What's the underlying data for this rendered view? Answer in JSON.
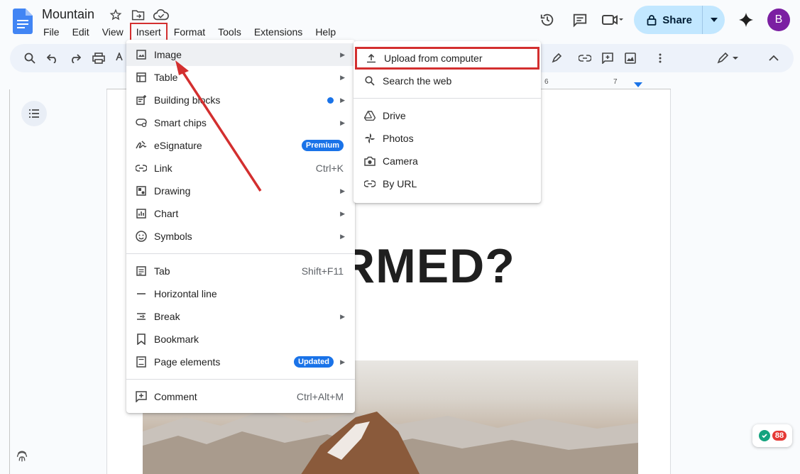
{
  "doc": {
    "title": "Mountain"
  },
  "menubar": [
    "File",
    "Edit",
    "View",
    "Insert",
    "Format",
    "Tools",
    "Extensions",
    "Help"
  ],
  "share": {
    "label": "Share"
  },
  "avatar": {
    "initial": "B",
    "color": "#7b1fa2"
  },
  "ruler": {
    "labels": [
      "6",
      "7"
    ]
  },
  "page": {
    "heading_fragment": "RMED?"
  },
  "insert_menu": {
    "items": [
      {
        "label": "Image",
        "icon": "image-icon",
        "submenu": true
      },
      {
        "label": "Table",
        "icon": "table-icon",
        "submenu": true
      },
      {
        "label": "Building blocks",
        "icon": "building-blocks-icon",
        "submenu": true,
        "new_dot": true
      },
      {
        "label": "Smart chips",
        "icon": "smart-chips-icon",
        "submenu": true
      },
      {
        "label": "eSignature",
        "icon": "signature-icon",
        "badge": "Premium"
      },
      {
        "label": "Link",
        "icon": "link-icon",
        "shortcut": "Ctrl+K"
      },
      {
        "label": "Drawing",
        "icon": "drawing-icon",
        "submenu": true
      },
      {
        "label": "Chart",
        "icon": "chart-icon",
        "submenu": true
      },
      {
        "label": "Symbols",
        "icon": "symbols-icon",
        "submenu": true
      },
      {
        "label": "Tab",
        "icon": "tab-icon",
        "shortcut": "Shift+F11"
      },
      {
        "label": "Horizontal line",
        "icon": "horizontal-line-icon"
      },
      {
        "label": "Break",
        "icon": "break-icon",
        "submenu": true
      },
      {
        "label": "Bookmark",
        "icon": "bookmark-icon"
      },
      {
        "label": "Page elements",
        "icon": "page-elements-icon",
        "submenu": true,
        "badge": "Updated"
      },
      {
        "label": "Comment",
        "icon": "comment-icon",
        "shortcut": "Ctrl+Alt+M"
      }
    ]
  },
  "image_submenu": {
    "items": [
      {
        "label": "Upload from computer",
        "icon": "upload-icon"
      },
      {
        "label": "Search the web",
        "icon": "search-icon"
      },
      {
        "label": "Drive",
        "icon": "drive-icon"
      },
      {
        "label": "Photos",
        "icon": "photos-icon"
      },
      {
        "label": "Camera",
        "icon": "camera-icon"
      },
      {
        "label": "By URL",
        "icon": "link-icon"
      }
    ]
  },
  "grammarly": {
    "count": "88"
  },
  "colors": {
    "highlight_box": "#d32f2f",
    "accent": "#1a73e8",
    "share_bg": "#c2e7ff"
  }
}
